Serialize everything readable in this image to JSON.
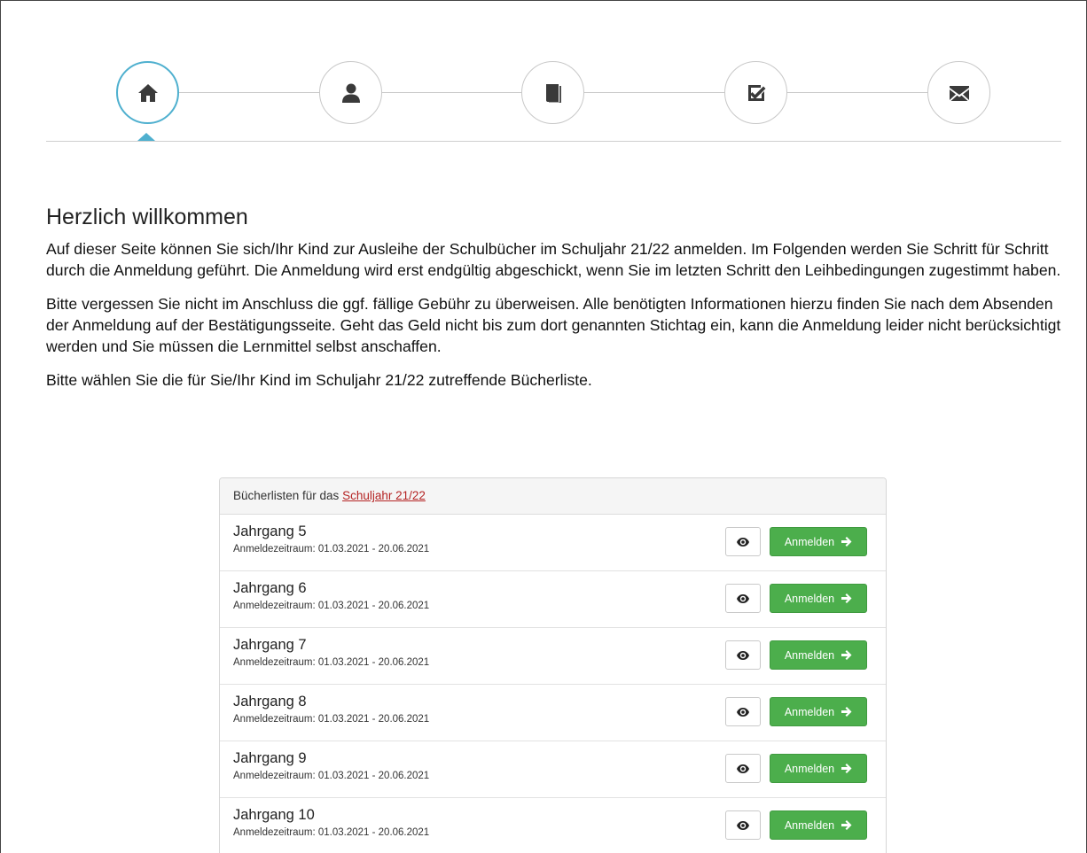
{
  "wizard": {
    "steps": [
      {
        "icon": "home-icon",
        "active": true
      },
      {
        "icon": "user-icon",
        "active": false
      },
      {
        "icon": "book-icon",
        "active": false
      },
      {
        "icon": "check-icon",
        "active": false
      },
      {
        "icon": "envelope-icon",
        "active": false
      }
    ],
    "accent_color": "#4fb0cf"
  },
  "intro": {
    "title": "Herzlich willkommen",
    "paragraph_1": "Auf dieser Seite können Sie sich/Ihr Kind zur Ausleihe der Schulbücher im Schuljahr 21/22 anmelden. Im Folgenden werden Sie Schritt für Schritt durch die Anmeldung geführt. Die Anmeldung wird erst endgültig abgeschickt, wenn Sie im letzten Schritt den Leihbedingungen zugestimmt haben.",
    "paragraph_2": "Bitte vergessen Sie nicht im Anschluss die ggf. fällige Gebühr zu überweisen. Alle benötigten Informationen hierzu finden Sie nach dem Absenden der Anmeldung auf der Bestätigungsseite. Geht das Geld nicht bis zum dort genannten Stichtag ein, kann die Anmeldung leider nicht berücksichtigt werden und Sie müssen die Lernmittel selbst anschaffen.",
    "paragraph_3": "Bitte wählen Sie die für Sie/Ihr Kind im Schuljahr 21/22 zutreffende Bücherliste."
  },
  "panel": {
    "heading_prefix": "Bücherlisten für das ",
    "heading_link": "Schuljahr 21/22",
    "button_color": "#4cae4c",
    "rows": [
      {
        "title": "Jahrgang 5",
        "period": "Anmeldezeitraum: 01.03.2021 - 20.06.2021",
        "button": "Anmelden"
      },
      {
        "title": "Jahrgang 6",
        "period": "Anmeldezeitraum: 01.03.2021 - 20.06.2021",
        "button": "Anmelden"
      },
      {
        "title": "Jahrgang 7",
        "period": "Anmeldezeitraum: 01.03.2021 - 20.06.2021",
        "button": "Anmelden"
      },
      {
        "title": "Jahrgang 8",
        "period": "Anmeldezeitraum: 01.03.2021 - 20.06.2021",
        "button": "Anmelden"
      },
      {
        "title": "Jahrgang 9",
        "period": "Anmeldezeitraum: 01.03.2021 - 20.06.2021",
        "button": "Anmelden"
      },
      {
        "title": "Jahrgang 10",
        "period": "Anmeldezeitraum: 01.03.2021 - 20.06.2021",
        "button": "Anmelden"
      }
    ]
  }
}
